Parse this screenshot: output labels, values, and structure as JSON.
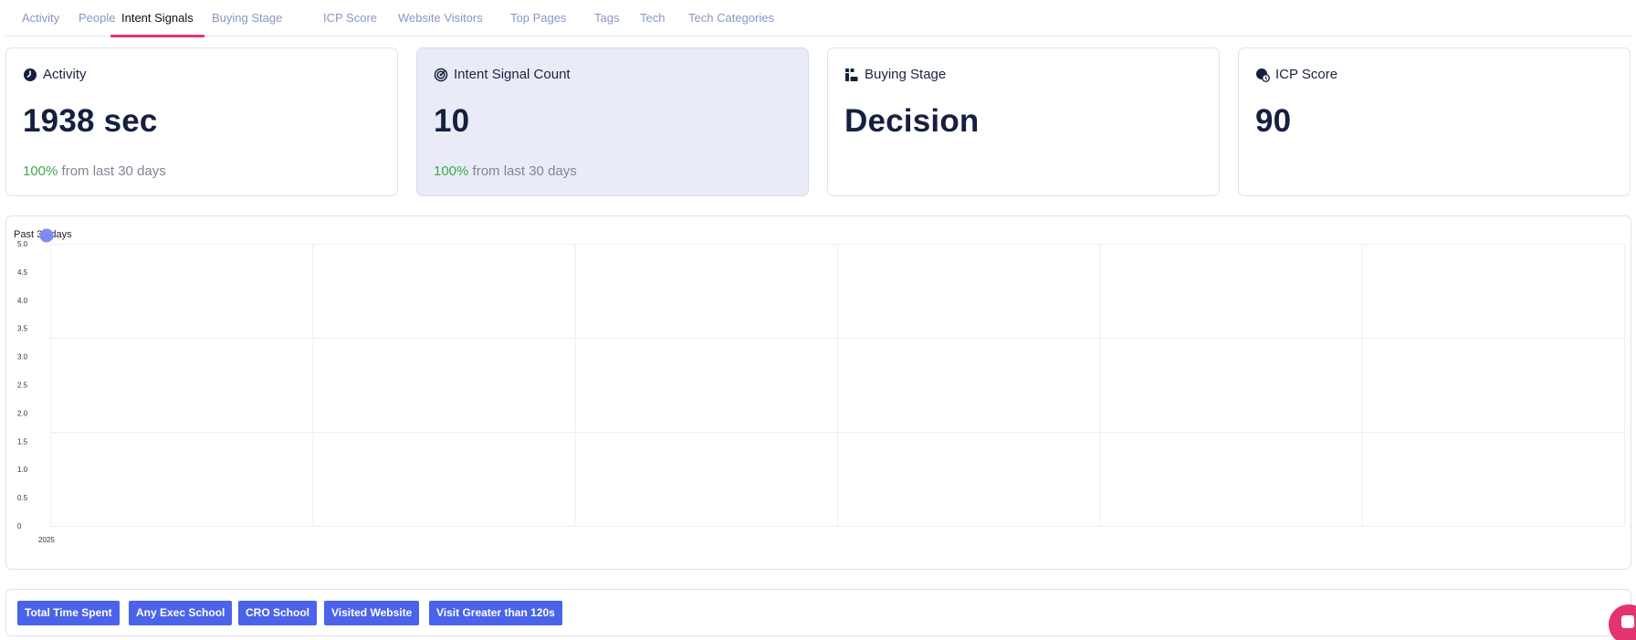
{
  "tabs": [
    {
      "label": "Activity",
      "active": false
    },
    {
      "label": "People",
      "active": false
    },
    {
      "label": "Intent Signals",
      "active": true
    },
    {
      "label": "Buying Stage",
      "active": false
    },
    {
      "label": "ICP Score",
      "active": false
    },
    {
      "label": "Website Visitors",
      "active": false
    },
    {
      "label": "Top Pages",
      "active": false
    },
    {
      "label": "Tags",
      "active": false
    },
    {
      "label": "Tech",
      "active": false
    },
    {
      "label": "Tech Categories",
      "active": false
    }
  ],
  "cards": {
    "activity": {
      "title": "Activity",
      "value": "1938 sec",
      "delta_pct": "100%",
      "delta_text": " from last 30 days",
      "icon": "clock-icon"
    },
    "intent": {
      "title": "Intent Signal Count",
      "value": "10",
      "delta_pct": "100%",
      "delta_text": " from last 30 days",
      "icon": "radar-icon"
    },
    "buying": {
      "title": "Buying Stage",
      "value": "Decision",
      "icon": "stages-icon"
    },
    "icp": {
      "title": "ICP Score",
      "value": "90",
      "icon": "target-badge-icon"
    }
  },
  "colors": {
    "accent_pink": "#e5336f",
    "tab_inactive": "#8a95c7",
    "positive_green": "#3aaa4a",
    "tag_blue": "#4a63ea",
    "point_color": "#7b8cf2"
  },
  "chart_data": {
    "type": "scatter",
    "caption": "Past 30 days",
    "x_tick_labels": [
      "2025"
    ],
    "y_ticks": [
      0,
      0.5,
      1.0,
      1.5,
      2.0,
      2.5,
      3.0,
      3.5,
      4.0,
      4.5,
      5.0
    ],
    "y_tick_labels": [
      "0",
      "0.5",
      "1.0",
      "1.5",
      "2.0",
      "2.5",
      "3.0",
      "3.5",
      "4.0",
      "4.5",
      "5.0"
    ],
    "ylim": [
      0,
      5
    ],
    "grid": true,
    "points": [
      {
        "x": "2025",
        "y": 5
      }
    ]
  },
  "tags": [
    "Total Time Spent",
    "Any Exec School",
    "CRO School",
    "Visited Website",
    "Visit Greater than 120s"
  ]
}
